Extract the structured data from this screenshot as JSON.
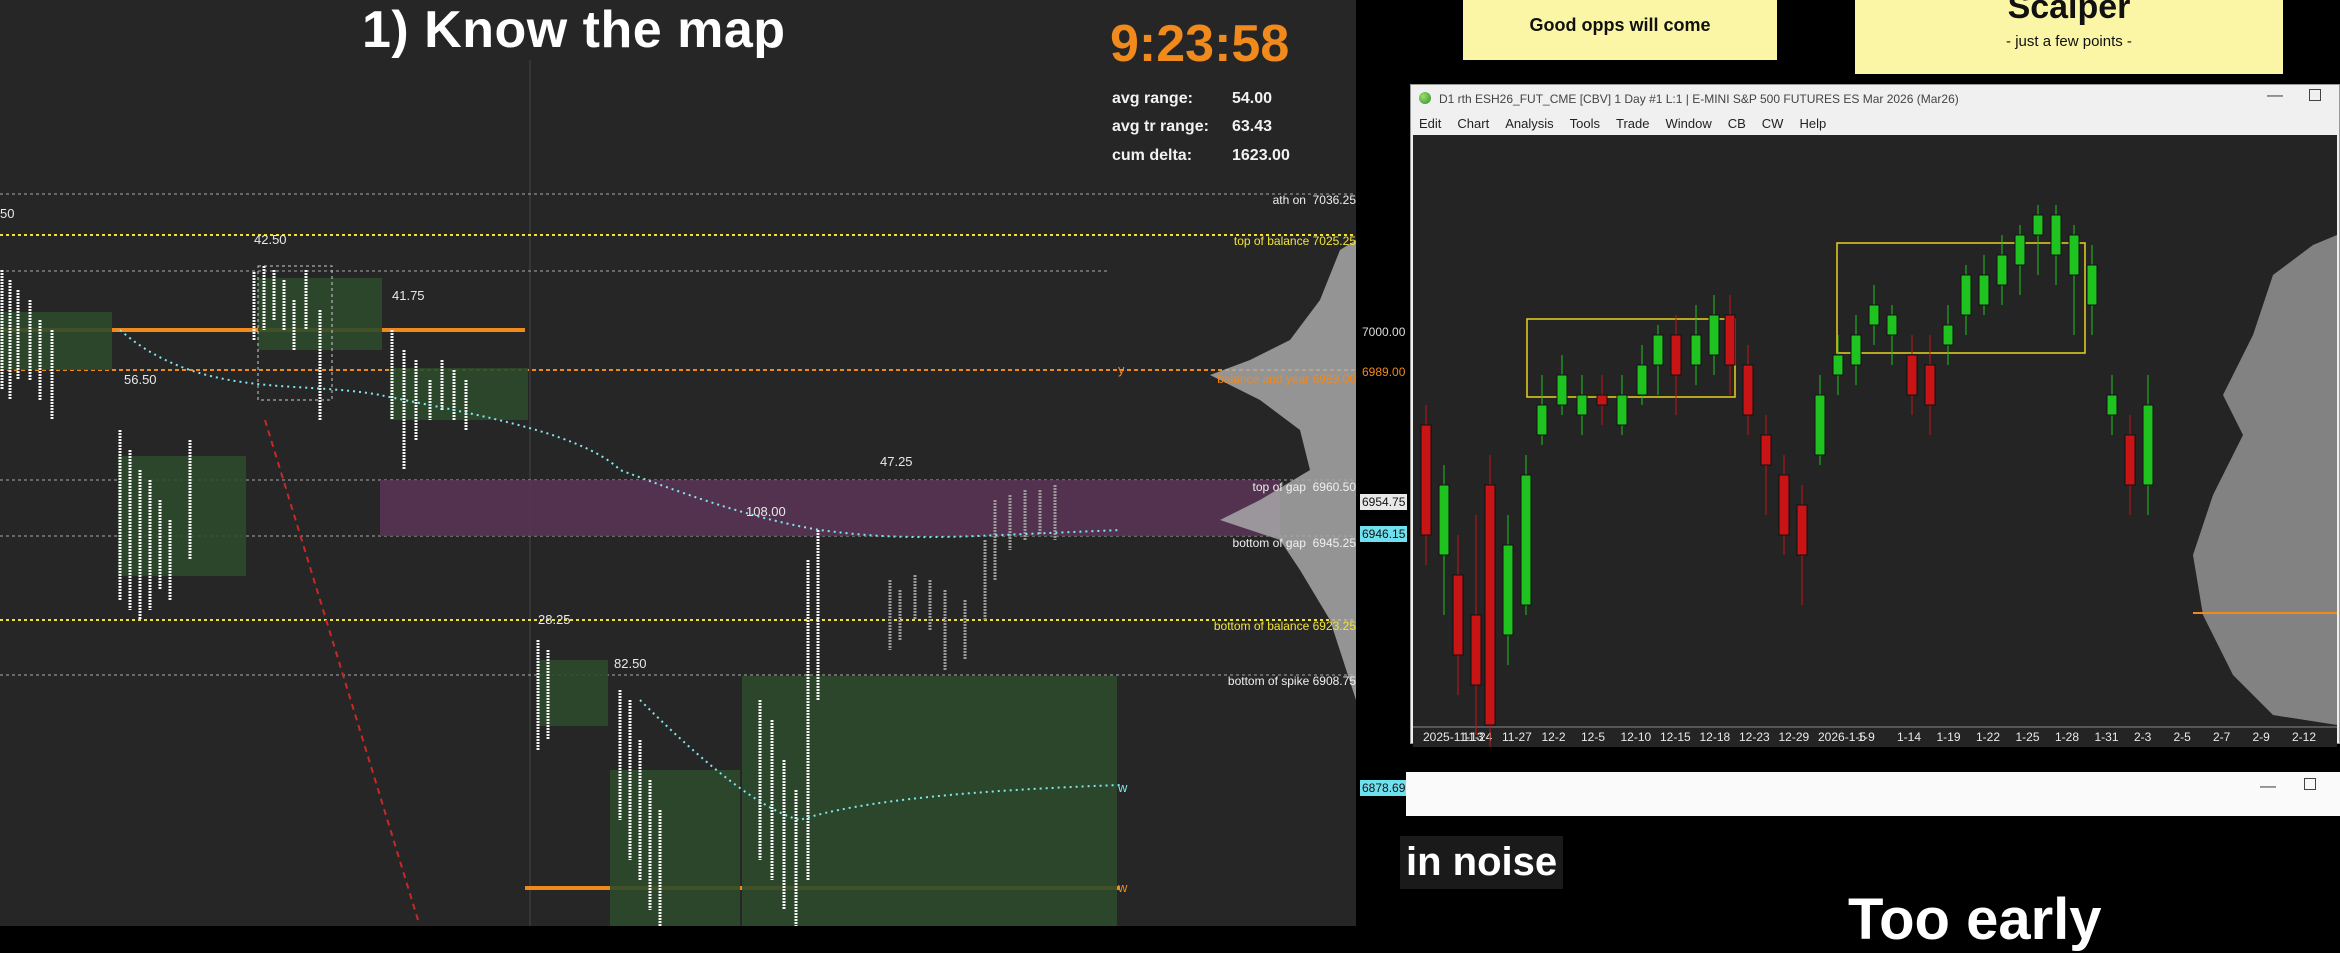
{
  "left": {
    "heading": "1)  Know the map",
    "clock": "9:23:58",
    "stats": [
      {
        "label": "avg range:",
        "value": "54.00"
      },
      {
        "label": "avg tr range:",
        "value": "63.43"
      },
      {
        "label": "cum delta:",
        "value": "1623.00"
      }
    ],
    "levels": [
      {
        "name": "ath on",
        "price": "7036.25"
      },
      {
        "name": "top of balance",
        "price": "7025.25"
      },
      {
        "name": "balance and year",
        "price": "6989.00"
      },
      {
        "name": "top of gap",
        "price": "6960.50"
      },
      {
        "name": "bottom of gap",
        "price": "6945.25"
      },
      {
        "name": "bottom of balance",
        "price": "6923.25"
      },
      {
        "name": "bottom of spike",
        "price": "6908.75"
      }
    ],
    "axis_tags": {
      "p7000": "7000.00",
      "p6989": "6989.00",
      "p6954": "6954.75",
      "p6946": "6946.15",
      "p6878": "6878.69"
    },
    "labels": {
      "l50": "50",
      "l4250": "42.50",
      "l4175": "41.75",
      "l5650": "56.50",
      "l4725": "47.25",
      "l108": "108.00",
      "l2825": "28.25",
      "l8250": "82.50",
      "y_mark": "y",
      "w_mark": "w",
      "w_mark2": "w"
    }
  },
  "right": {
    "note1": "Good opps will come",
    "note2_title": "Scalper",
    "note2_sub": "-  just a few points  -",
    "window_title": "D1 rth ESH26_FUT_CME [CBV]  1 Day  #1 L:1 | E-MINI S&P 500 FUTURES ES Mar 2026 (Mar26)",
    "menu": [
      "Edit",
      "Chart",
      "Analysis",
      "Tools",
      "Trade",
      "Window",
      "CB",
      "CW",
      "Help"
    ],
    "dates": [
      "2025-11-13",
      "11-24",
      "11-27",
      "12-2",
      "12-5",
      "12-10",
      "12-15",
      "12-18",
      "12-23",
      "12-29",
      "2026-1-5",
      "1-9",
      "1-14",
      "1-19",
      "1-22",
      "1-25",
      "1-28",
      "1-31",
      "2-3",
      "2-5",
      "2-7",
      "2-9",
      "2-12"
    ],
    "noise_text": "in noise",
    "too_early": "Too early"
  },
  "colors": {
    "up": "#1fc31f",
    "down": "#c81414",
    "balance_box": "#e6d21e",
    "orange": "#f08a1c",
    "yellow": "#f2e33a"
  },
  "icons": [
    "window-globe-icon",
    "minimize-icon",
    "maximize-icon"
  ]
}
